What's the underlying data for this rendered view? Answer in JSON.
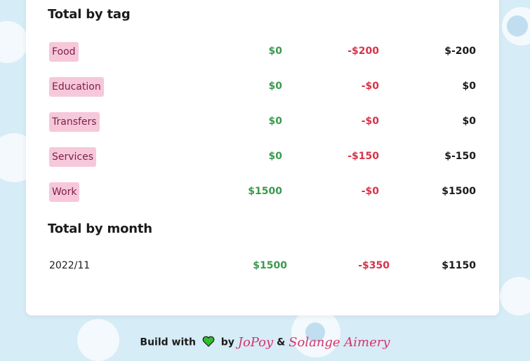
{
  "sections": {
    "by_tag_title": "Total by tag",
    "by_month_title": "Total by month"
  },
  "tags": [
    {
      "name": "Food",
      "income": "$0",
      "expense": "-$200",
      "total": "$-200"
    },
    {
      "name": "Education",
      "income": "$0",
      "expense": "-$0",
      "total": "$0"
    },
    {
      "name": "Transfers",
      "income": "$0",
      "expense": "-$0",
      "total": "$0"
    },
    {
      "name": "Services",
      "income": "$0",
      "expense": "-$150",
      "total": "$-150"
    },
    {
      "name": "Work",
      "income": "$1500",
      "expense": "-$0",
      "total": "$1500"
    }
  ],
  "months": [
    {
      "name": "2022/11",
      "income": "$1500",
      "expense": "-$350",
      "total": "$1150"
    }
  ],
  "footer": {
    "build_with": "Build with",
    "by": "by",
    "author1": "JoPoy",
    "amp": "&",
    "author2": "Solange Aimery"
  },
  "colors": {
    "income": "#3c9a4e",
    "expense": "#d6344a",
    "tag_bg": "#f6c8da",
    "heart": "#2fbf2f"
  }
}
